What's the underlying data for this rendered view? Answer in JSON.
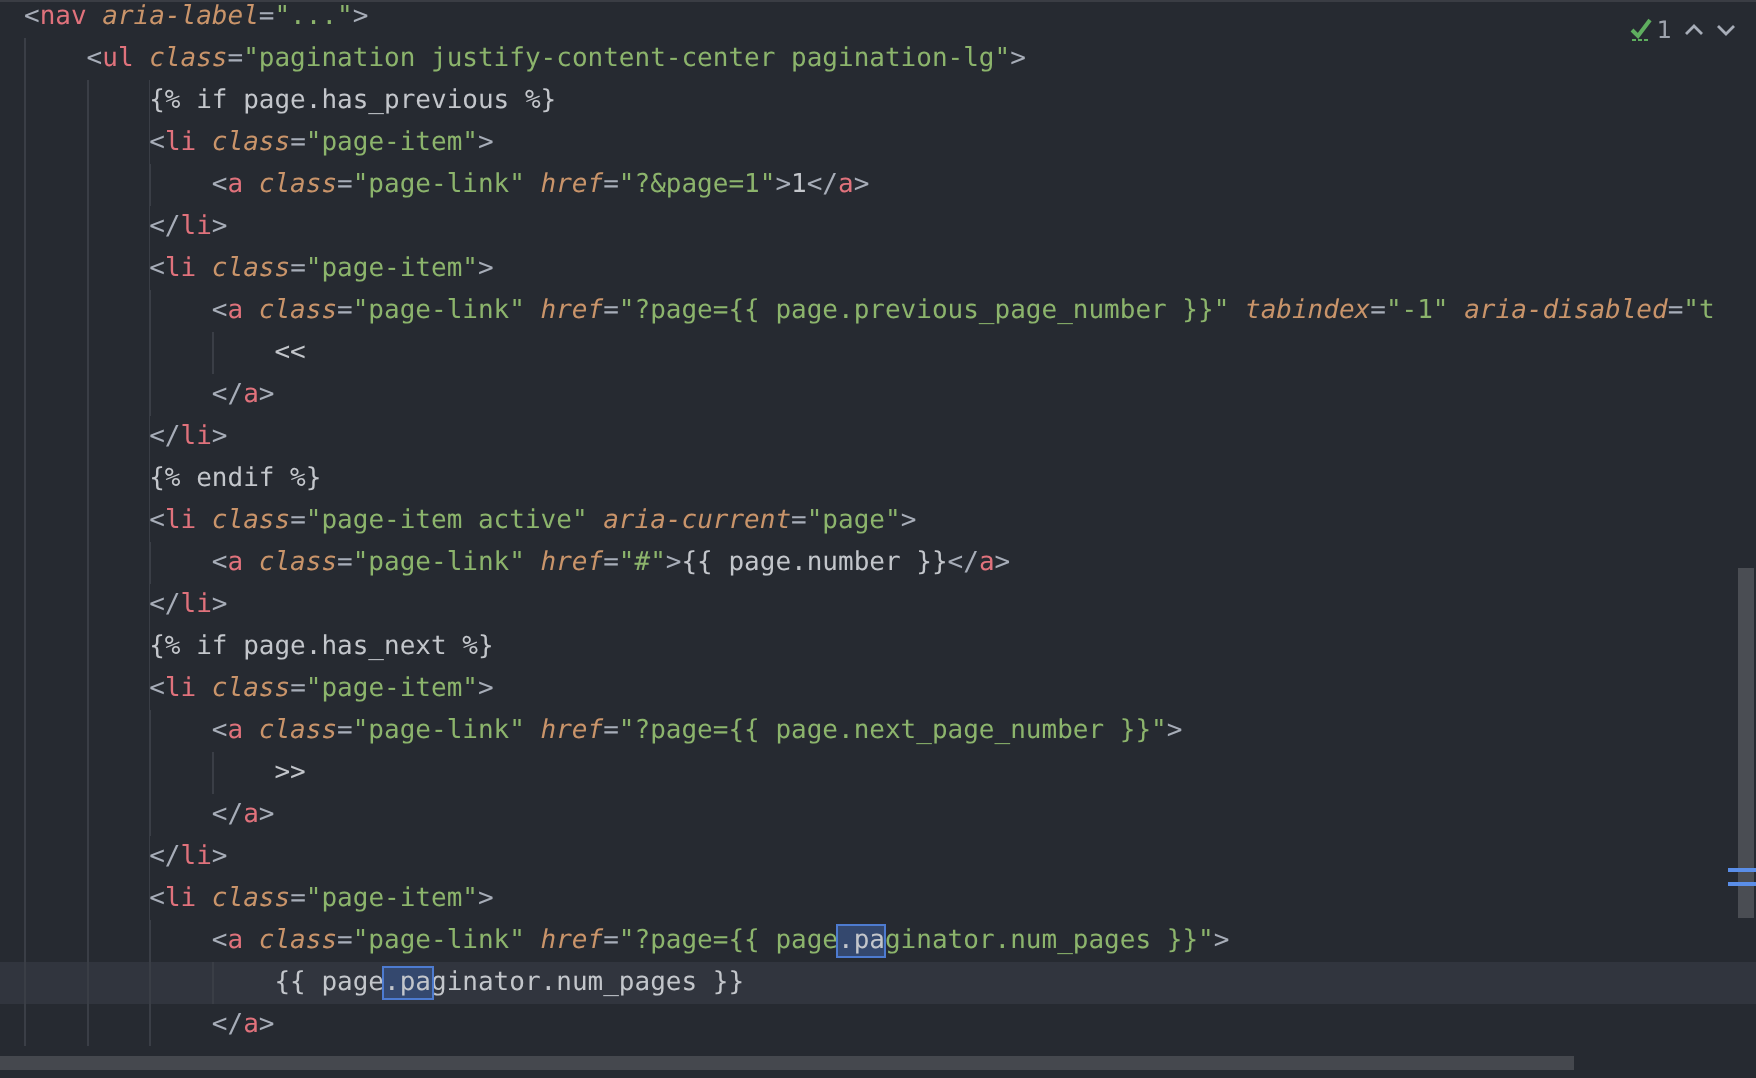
{
  "inspection": {
    "count": "1"
  },
  "lines": [
    {
      "current": false,
      "tokens": [
        {
          "kind": "punct",
          "text": "<"
        },
        {
          "kind": "tag",
          "text": "nav"
        },
        {
          "kind": "attr",
          "text": " aria-label"
        },
        {
          "kind": "punct",
          "text": "="
        },
        {
          "kind": "string",
          "text": "\"...\""
        },
        {
          "kind": "punct",
          "text": ">"
        }
      ],
      "children": [
        {
          "current": false,
          "tokens": [
            {
              "kind": "punct",
              "text": "<"
            },
            {
              "kind": "tag",
              "text": "ul"
            },
            {
              "kind": "attr",
              "text": " class"
            },
            {
              "kind": "punct",
              "text": "="
            },
            {
              "kind": "string",
              "text": "\"pagination justify-content-center pagination-lg\""
            },
            {
              "kind": "punct",
              "text": ">"
            }
          ],
          "children": [
            {
              "current": false,
              "tokens": [
                {
                  "kind": "text",
                  "text": "{% if page.has_previous %}"
                }
              ]
            },
            {
              "current": false,
              "tokens": [
                {
                  "kind": "punct",
                  "text": "<"
                },
                {
                  "kind": "tag",
                  "text": "li"
                },
                {
                  "kind": "attr",
                  "text": " class"
                },
                {
                  "kind": "punct",
                  "text": "="
                },
                {
                  "kind": "string",
                  "text": "\"page-item\""
                },
                {
                  "kind": "punct",
                  "text": ">"
                }
              ],
              "children": [
                {
                  "current": false,
                  "tokens": [
                    {
                      "kind": "punct",
                      "text": "<"
                    },
                    {
                      "kind": "tag",
                      "text": "a"
                    },
                    {
                      "kind": "attr",
                      "text": " class"
                    },
                    {
                      "kind": "punct",
                      "text": "="
                    },
                    {
                      "kind": "string",
                      "text": "\"page-link\""
                    },
                    {
                      "kind": "attr",
                      "text": " href"
                    },
                    {
                      "kind": "punct",
                      "text": "="
                    },
                    {
                      "kind": "string",
                      "text": "\"?&page=1\""
                    },
                    {
                      "kind": "punct",
                      "text": ">"
                    },
                    {
                      "kind": "text",
                      "text": "1"
                    },
                    {
                      "kind": "punct",
                      "text": "</"
                    },
                    {
                      "kind": "tag",
                      "text": "a"
                    },
                    {
                      "kind": "punct",
                      "text": ">"
                    }
                  ]
                }
              ]
            },
            {
              "current": false,
              "tokens": [
                {
                  "kind": "punct",
                  "text": "</"
                },
                {
                  "kind": "tag",
                  "text": "li"
                },
                {
                  "kind": "punct",
                  "text": ">"
                }
              ]
            },
            {
              "current": false,
              "tokens": [
                {
                  "kind": "punct",
                  "text": "<"
                },
                {
                  "kind": "tag",
                  "text": "li"
                },
                {
                  "kind": "attr",
                  "text": " class"
                },
                {
                  "kind": "punct",
                  "text": "="
                },
                {
                  "kind": "string",
                  "text": "\"page-item\""
                },
                {
                  "kind": "punct",
                  "text": ">"
                }
              ],
              "children": [
                {
                  "current": false,
                  "tokens": [
                    {
                      "kind": "punct",
                      "text": "<"
                    },
                    {
                      "kind": "tag",
                      "text": "a"
                    },
                    {
                      "kind": "attr",
                      "text": " class"
                    },
                    {
                      "kind": "punct",
                      "text": "="
                    },
                    {
                      "kind": "string",
                      "text": "\"page-link\""
                    },
                    {
                      "kind": "attr",
                      "text": " href"
                    },
                    {
                      "kind": "punct",
                      "text": "="
                    },
                    {
                      "kind": "string",
                      "text": "\"?page={{ page.previous_page_number }}\""
                    },
                    {
                      "kind": "attr",
                      "text": " tabindex"
                    },
                    {
                      "kind": "punct",
                      "text": "="
                    },
                    {
                      "kind": "string",
                      "text": "\"-1\""
                    },
                    {
                      "kind": "attr",
                      "text": " aria-disabled"
                    },
                    {
                      "kind": "punct",
                      "text": "="
                    },
                    {
                      "kind": "string",
                      "text": "\"t"
                    }
                  ],
                  "children": [
                    {
                      "current": false,
                      "tokens": [
                        {
                          "kind": "text",
                          "text": "<<"
                        }
                      ]
                    }
                  ]
                },
                {
                  "current": false,
                  "tokens": [
                    {
                      "kind": "punct",
                      "text": "</"
                    },
                    {
                      "kind": "tag",
                      "text": "a"
                    },
                    {
                      "kind": "punct",
                      "text": ">"
                    }
                  ]
                }
              ]
            },
            {
              "current": false,
              "tokens": [
                {
                  "kind": "punct",
                  "text": "</"
                },
                {
                  "kind": "tag",
                  "text": "li"
                },
                {
                  "kind": "punct",
                  "text": ">"
                }
              ]
            },
            {
              "current": false,
              "tokens": [
                {
                  "kind": "text",
                  "text": "{% endif %}"
                }
              ]
            },
            {
              "current": false,
              "tokens": [
                {
                  "kind": "punct",
                  "text": "<"
                },
                {
                  "kind": "tag",
                  "text": "li"
                },
                {
                  "kind": "attr",
                  "text": " class"
                },
                {
                  "kind": "punct",
                  "text": "="
                },
                {
                  "kind": "string",
                  "text": "\"page-item active\""
                },
                {
                  "kind": "attr",
                  "text": " aria-current"
                },
                {
                  "kind": "punct",
                  "text": "="
                },
                {
                  "kind": "string",
                  "text": "\"page\""
                },
                {
                  "kind": "punct",
                  "text": ">"
                }
              ],
              "children": [
                {
                  "current": false,
                  "tokens": [
                    {
                      "kind": "punct",
                      "text": "<"
                    },
                    {
                      "kind": "tag",
                      "text": "a"
                    },
                    {
                      "kind": "attr",
                      "text": " class"
                    },
                    {
                      "kind": "punct",
                      "text": "="
                    },
                    {
                      "kind": "string",
                      "text": "\"page-link\""
                    },
                    {
                      "kind": "attr",
                      "text": " href"
                    },
                    {
                      "kind": "punct",
                      "text": "="
                    },
                    {
                      "kind": "string",
                      "text": "\"#\""
                    },
                    {
                      "kind": "punct",
                      "text": ">"
                    },
                    {
                      "kind": "text",
                      "text": "{{ page.number }}"
                    },
                    {
                      "kind": "punct",
                      "text": "</"
                    },
                    {
                      "kind": "tag",
                      "text": "a"
                    },
                    {
                      "kind": "punct",
                      "text": ">"
                    }
                  ]
                }
              ]
            },
            {
              "current": false,
              "tokens": [
                {
                  "kind": "punct",
                  "text": "</"
                },
                {
                  "kind": "tag",
                  "text": "li"
                },
                {
                  "kind": "punct",
                  "text": ">"
                }
              ]
            },
            {
              "current": false,
              "tokens": [
                {
                  "kind": "text",
                  "text": "{% if page.has_next %}"
                }
              ]
            },
            {
              "current": false,
              "tokens": [
                {
                  "kind": "punct",
                  "text": "<"
                },
                {
                  "kind": "tag",
                  "text": "li"
                },
                {
                  "kind": "attr",
                  "text": " class"
                },
                {
                  "kind": "punct",
                  "text": "="
                },
                {
                  "kind": "string",
                  "text": "\"page-item\""
                },
                {
                  "kind": "punct",
                  "text": ">"
                }
              ],
              "children": [
                {
                  "current": false,
                  "tokens": [
                    {
                      "kind": "punct",
                      "text": "<"
                    },
                    {
                      "kind": "tag",
                      "text": "a"
                    },
                    {
                      "kind": "attr",
                      "text": " class"
                    },
                    {
                      "kind": "punct",
                      "text": "="
                    },
                    {
                      "kind": "string",
                      "text": "\"page-link\""
                    },
                    {
                      "kind": "attr",
                      "text": " href"
                    },
                    {
                      "kind": "punct",
                      "text": "="
                    },
                    {
                      "kind": "string",
                      "text": "\"?page={{ page.next_page_number }}\""
                    },
                    {
                      "kind": "punct",
                      "text": ">"
                    }
                  ],
                  "children": [
                    {
                      "current": false,
                      "tokens": [
                        {
                          "kind": "text",
                          "text": ">>"
                        }
                      ]
                    }
                  ]
                },
                {
                  "current": false,
                  "tokens": [
                    {
                      "kind": "punct",
                      "text": "</"
                    },
                    {
                      "kind": "tag",
                      "text": "a"
                    },
                    {
                      "kind": "punct",
                      "text": ">"
                    }
                  ]
                }
              ]
            },
            {
              "current": false,
              "tokens": [
                {
                  "kind": "punct",
                  "text": "</"
                },
                {
                  "kind": "tag",
                  "text": "li"
                },
                {
                  "kind": "punct",
                  "text": ">"
                }
              ]
            },
            {
              "current": false,
              "tokens": [
                {
                  "kind": "punct",
                  "text": "<"
                },
                {
                  "kind": "tag",
                  "text": "li"
                },
                {
                  "kind": "attr",
                  "text": " class"
                },
                {
                  "kind": "punct",
                  "text": "="
                },
                {
                  "kind": "string",
                  "text": "\"page-item\""
                },
                {
                  "kind": "punct",
                  "text": ">"
                }
              ],
              "children": [
                {
                  "current": false,
                  "tokens": [
                    {
                      "kind": "punct",
                      "text": "<"
                    },
                    {
                      "kind": "tag",
                      "text": "a"
                    },
                    {
                      "kind": "attr",
                      "text": " class"
                    },
                    {
                      "kind": "punct",
                      "text": "="
                    },
                    {
                      "kind": "string",
                      "text": "\"page-link\""
                    },
                    {
                      "kind": "attr",
                      "text": " href"
                    },
                    {
                      "kind": "punct",
                      "text": "="
                    },
                    {
                      "kind": "string",
                      "text": "\"?page={{ page"
                    },
                    {
                      "kind": "match",
                      "text": ".pa"
                    },
                    {
                      "kind": "string",
                      "text": "ginator.num_pages }}\""
                    },
                    {
                      "kind": "punct",
                      "text": ">"
                    }
                  ],
                  "children": [
                    {
                      "current": true,
                      "tokens": [
                        {
                          "kind": "text",
                          "text": "{{ page"
                        },
                        {
                          "kind": "match",
                          "text": ".pa"
                        },
                        {
                          "kind": "text",
                          "text": "ginator.num_pages }}"
                        }
                      ]
                    }
                  ]
                },
                {
                  "current": false,
                  "tokens": [
                    {
                      "kind": "punct",
                      "text": "</"
                    },
                    {
                      "kind": "tag",
                      "text": "a"
                    },
                    {
                      "kind": "punct",
                      "text": ">"
                    }
                  ]
                }
              ]
            }
          ]
        }
      ]
    }
  ]
}
